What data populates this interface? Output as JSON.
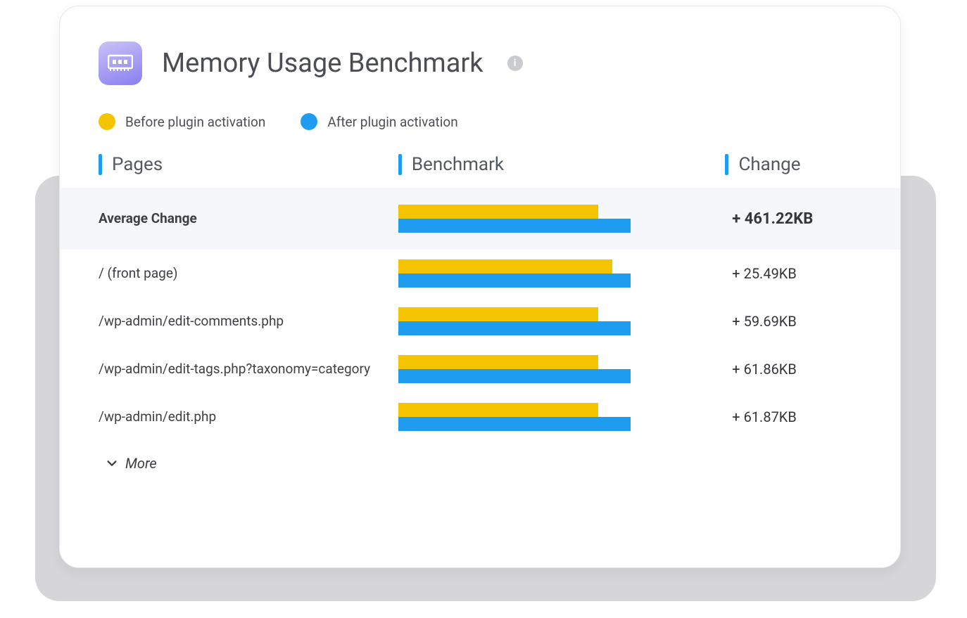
{
  "header": {
    "title": "Memory Usage Benchmark",
    "icon": "memory-chip-icon",
    "info_icon": "info-icon"
  },
  "legend": {
    "before": {
      "label": "Before plugin activation",
      "color": "#f5c400"
    },
    "after": {
      "label": "After plugin activation",
      "color": "#1e9cf0"
    }
  },
  "columns": {
    "pages": "Pages",
    "benchmark": "Benchmark",
    "change": "Change"
  },
  "chart_data": {
    "type": "bar",
    "orientation": "horizontal",
    "series_names": [
      "Before plugin activation",
      "After plugin activation"
    ],
    "rows": [
      {
        "label": "Average Change",
        "before_pct": 86,
        "after_pct": 100,
        "change": "+ 461.22KB",
        "highlight": true
      },
      {
        "label": "/ (front page)",
        "before_pct": 92,
        "after_pct": 100,
        "change": "+ 25.49KB",
        "highlight": false
      },
      {
        "label": "/wp-admin/edit-comments.php",
        "before_pct": 86,
        "after_pct": 100,
        "change": "+ 59.69KB",
        "highlight": false
      },
      {
        "label": "/wp-admin/edit-tags.php?taxonomy=category",
        "before_pct": 86,
        "after_pct": 100,
        "change": "+ 61.86KB",
        "highlight": false
      },
      {
        "label": "/wp-admin/edit.php",
        "before_pct": 86,
        "after_pct": 100,
        "change": "+ 61.87KB",
        "highlight": false
      }
    ]
  },
  "more_label": "More"
}
